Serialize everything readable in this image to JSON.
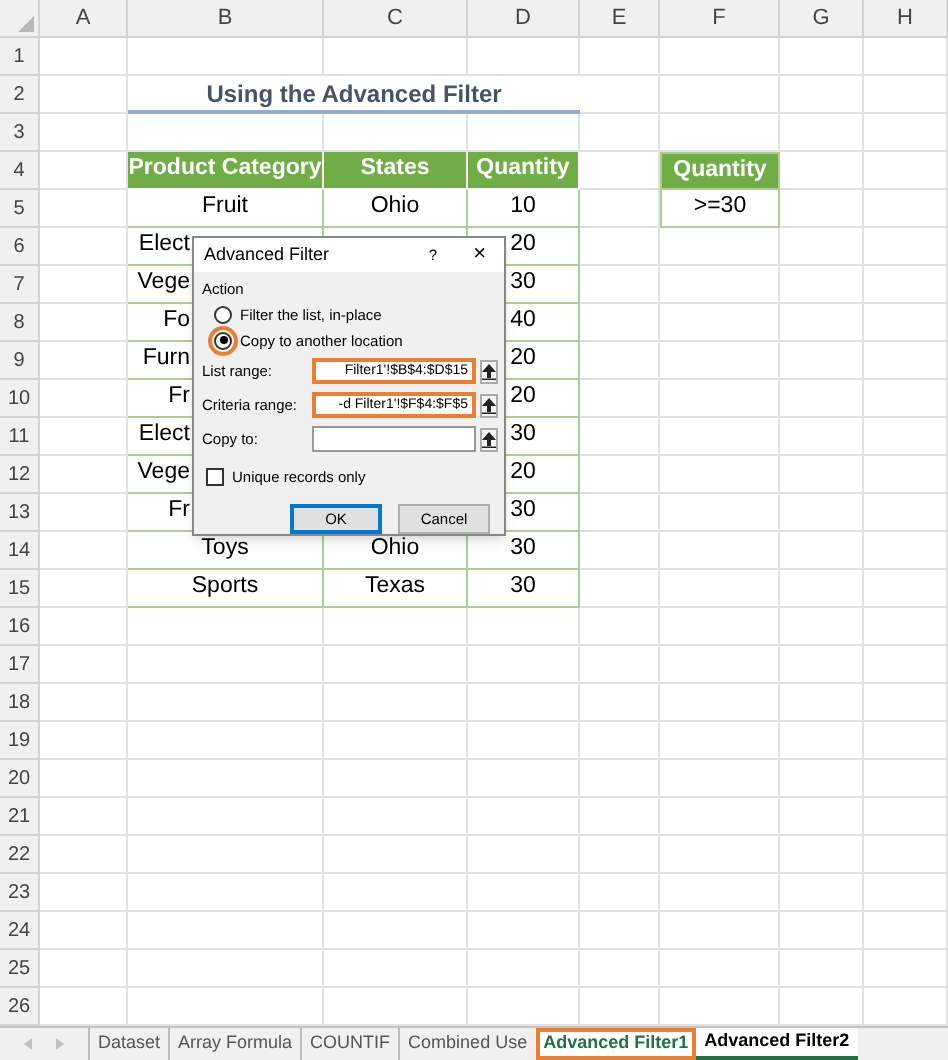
{
  "columns": [
    "A",
    "B",
    "C",
    "D",
    "E",
    "F",
    "G",
    "H"
  ],
  "row_numbers": [
    "1",
    "2",
    "3",
    "4",
    "5",
    "6",
    "7",
    "8",
    "9",
    "10",
    "11",
    "12",
    "13",
    "14",
    "15",
    "16",
    "17",
    "18",
    "19",
    "20",
    "21",
    "22",
    "23",
    "24",
    "25",
    "26"
  ],
  "title": "Using the Advanced Filter",
  "table": {
    "columns": [
      "Product Category",
      "States",
      "Quantity"
    ],
    "rows": [
      {
        "product": "Fruit",
        "state": "Ohio",
        "quantity": "10"
      },
      {
        "product": "Elect",
        "quantity": "20"
      },
      {
        "product": "Vege",
        "quantity": "30"
      },
      {
        "product": "Fo",
        "quantity": "40"
      },
      {
        "product": "Furn",
        "quantity": "20"
      },
      {
        "product": "Fr",
        "quantity": "20"
      },
      {
        "product": "Elect",
        "quantity": "30"
      },
      {
        "product": "Vege",
        "quantity": "20"
      },
      {
        "product": "Fr",
        "quantity": "30"
      },
      {
        "product": "Toys",
        "state": "Ohio",
        "quantity": "30"
      },
      {
        "product": "Sports",
        "state": "Texas",
        "quantity": "30"
      }
    ]
  },
  "criteria": {
    "header": "Quantity",
    "value": ">=30"
  },
  "dialog": {
    "title": "Advanced Filter",
    "help": "?",
    "close": "×",
    "group": "Action",
    "options": [
      {
        "label": "Filter the list, in-place",
        "selected": false,
        "highlighted": false
      },
      {
        "label": "Copy to another location",
        "selected": true,
        "highlighted": true
      }
    ],
    "fields": [
      {
        "label": "List range:",
        "value": "Filter1'!$B$4:$D$15",
        "highlighted": true
      },
      {
        "label": "Criteria range:",
        "value": "-d Filter1'!$F$4:$F$5",
        "highlighted": true
      },
      {
        "label": "Copy to:",
        "highlighted": false
      }
    ],
    "unique": {
      "label": "Unique records only",
      "checked": false
    },
    "ok": "OK",
    "cancel": "Cancel"
  },
  "sheet_tabs": [
    {
      "label": "Dataset",
      "selected": false,
      "highlighted": false
    },
    {
      "label": "Array Formula",
      "selected": false,
      "highlighted": false
    },
    {
      "label": "COUNTIF",
      "selected": false,
      "highlighted": false
    },
    {
      "label": "Combined Use",
      "selected": false,
      "highlighted": false
    },
    {
      "label": "Advanced Filter1",
      "selected": true,
      "highlighted": true
    },
    {
      "label": "Advanced Filter2",
      "selected": false,
      "highlighted": false
    }
  ]
}
